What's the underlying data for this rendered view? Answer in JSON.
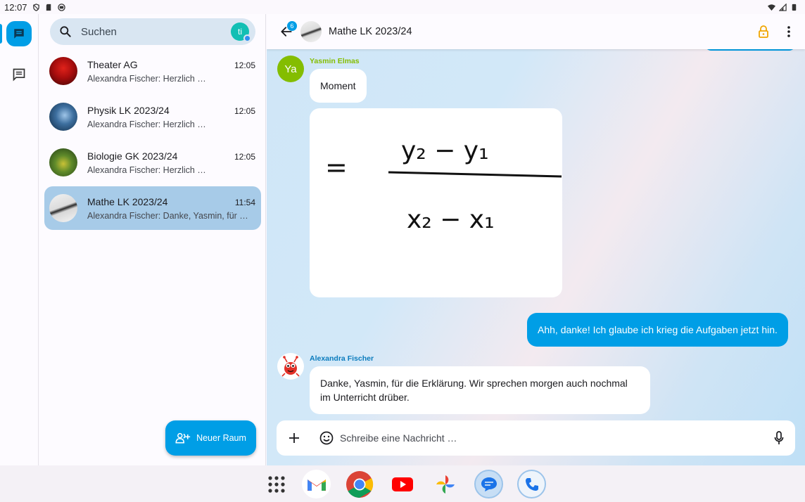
{
  "status_bar": {
    "time": "12:07"
  },
  "nav_rail": {
    "items": [
      {
        "icon": "chat-icon",
        "active": true
      },
      {
        "icon": "chat-outline-icon",
        "active": false
      }
    ]
  },
  "search": {
    "placeholder": "Suchen",
    "avatar_initials": "ti"
  },
  "chats": [
    {
      "title": "Theater AG",
      "time": "12:05",
      "preview": "Alexandra Fischer: Herzlich …",
      "active": false
    },
    {
      "title": "Physik LK 2023/24",
      "time": "12:05",
      "preview": "Alexandra Fischer: Herzlich …",
      "active": false
    },
    {
      "title": "Biologie GK 2023/24",
      "time": "12:05",
      "preview": "Alexandra Fischer: Herzlich …",
      "active": false
    },
    {
      "title": "Mathe LK 2023/24",
      "time": "11:54",
      "preview": "Alexandra Fischer: Danke, Yasmin, für …",
      "active": true
    }
  ],
  "fab": {
    "label": "Neuer Raum"
  },
  "chat_header": {
    "title": "Mathe LK 2023/24",
    "badge": "6"
  },
  "messages": [
    {
      "sender": "Yasmin Elmas",
      "initials": "Ya",
      "text": "Moment",
      "sender_color": "#84bd00"
    },
    {
      "image_formula": {
        "numerator": "y₂ − y₁",
        "denominator": "x₂ − x₁",
        "equals": "="
      }
    },
    {
      "own": true,
      "text": "Ahh, danke! Ich glaube ich krieg die Aufgaben jetzt hin."
    },
    {
      "sender": "Alexandra Fischer",
      "text": "Danke, Yasmin, für die Erklärung. Wir sprechen morgen auch nochmal im Unterricht drüber.",
      "sender_color": "#0a7bbd"
    }
  ],
  "composer": {
    "placeholder": "Schreibe eine Nachricht …"
  },
  "colors": {
    "accent": "#009ee6",
    "active_chat": "#a7cbe8",
    "search_bg": "#d9e6f2"
  },
  "dock": {
    "apps": [
      "app-grid-icon",
      "gmail-icon",
      "chrome-icon",
      "youtube-icon",
      "photos-icon",
      "messages-icon",
      "phone-icon"
    ]
  }
}
